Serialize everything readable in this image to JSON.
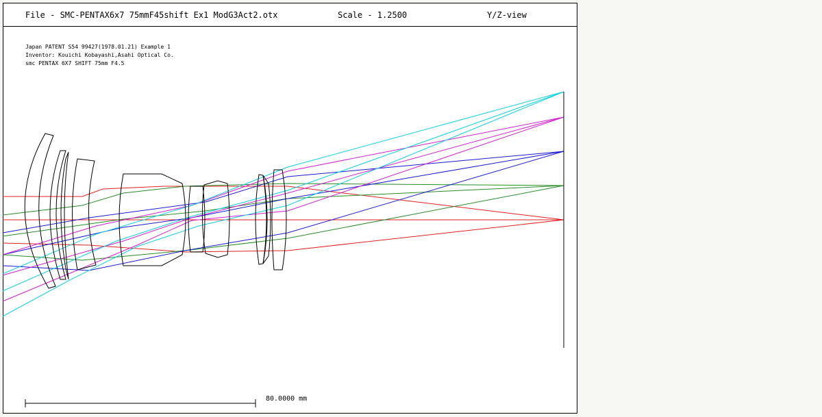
{
  "header": {
    "title": "File - SMC-PENTAX6x7 75mmF45shift Ex1 ModG3Act2.otx",
    "scale": "Scale - 1.2500",
    "view": "Y/Z-view"
  },
  "notes": [
    "Japan PATENT S54 99427(1978.01.21) Example 1",
    "Inventor: Kouichi Kobayashi,Asahi Optical Co.",
    "smc PENTAX 6X7 SHIFT 75mm F4.5"
  ],
  "scalebar": {
    "label": "80.0000 mm"
  },
  "colors": {
    "lens": "#000000",
    "axis_field": "#e02020",
    "field_2": "#2a8a2a",
    "field_3": "#1a1ad0",
    "field_4": "#d020d0",
    "field_5": "#10d0e0"
  }
}
